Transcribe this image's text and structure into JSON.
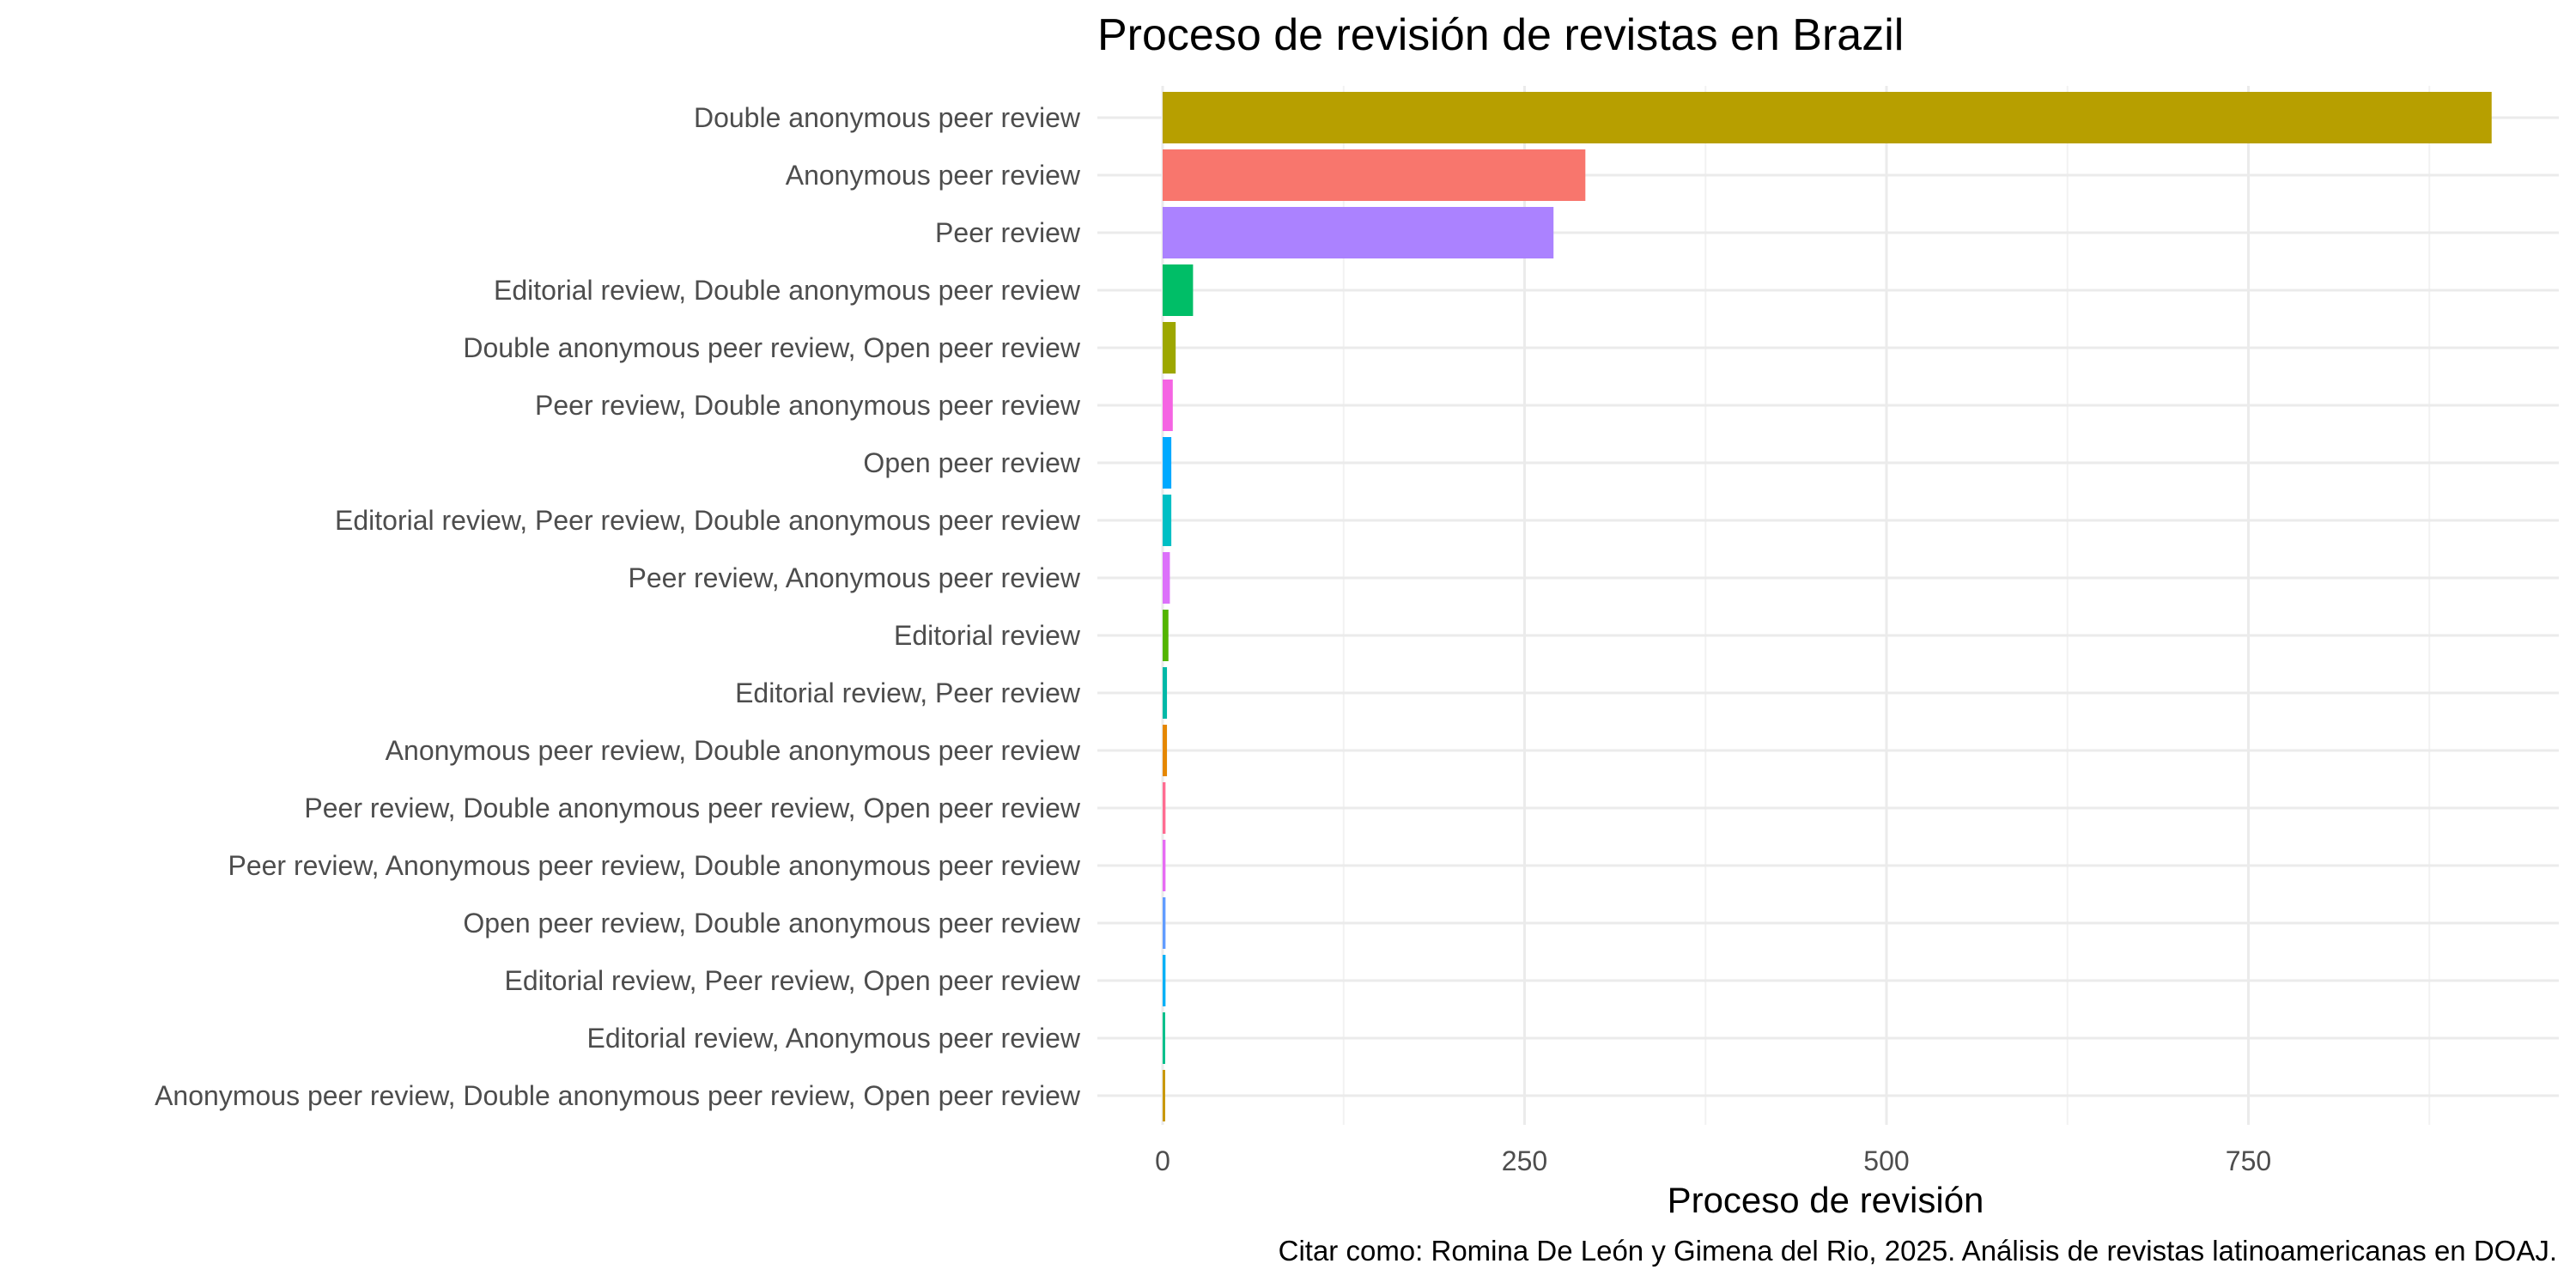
{
  "chart_data": {
    "type": "bar",
    "orientation": "horizontal",
    "title": "Proceso de revisión de revistas en Brazil",
    "xlabel": "Proceso de revisión",
    "ylabel": "",
    "caption": "Citar como: Romina De León y Gimena del Rio, 2025. Análisis de revistas latinoamericanas en DOAJ.",
    "xlim": [
      0,
      920
    ],
    "xticks": [
      0,
      250,
      500,
      750
    ],
    "xtick_labels": [
      "0",
      "250",
      "500",
      "750"
    ],
    "grid": true,
    "legend": "none",
    "categories": [
      "Double anonymous peer review",
      "Anonymous peer review",
      "Peer review",
      "Editorial review, Double anonymous peer review",
      "Double anonymous peer review, Open peer review",
      "Peer review, Double anonymous peer review",
      "Open peer review",
      "Editorial review, Peer review, Double anonymous peer review",
      "Peer review, Anonymous peer review",
      "Editorial review",
      "Editorial review, Peer review",
      "Anonymous peer review, Double anonymous peer review",
      "Peer review, Double anonymous peer review, Open peer review",
      "Peer review, Anonymous peer review, Double anonymous peer review",
      "Open peer review, Double anonymous peer review",
      "Editorial review, Peer review, Open peer review",
      "Editorial review, Anonymous peer review",
      "Anonymous peer review, Double anonymous peer review, Open peer review"
    ],
    "values": [
      918,
      292,
      270,
      21,
      9,
      7,
      6,
      6,
      5,
      4,
      3,
      3,
      2,
      2,
      2,
      2,
      1,
      1
    ],
    "colors": [
      "#B79F00",
      "#F8766D",
      "#AB82FF",
      "#00BE67",
      "#9DA700",
      "#F564E3",
      "#00A9FF",
      "#00BFC4",
      "#DC71FA",
      "#53B400",
      "#00B8A7",
      "#E58700",
      "#FF6C91",
      "#E76BF3",
      "#619CFF",
      "#00B0F6",
      "#00C08B",
      "#C99800"
    ]
  }
}
